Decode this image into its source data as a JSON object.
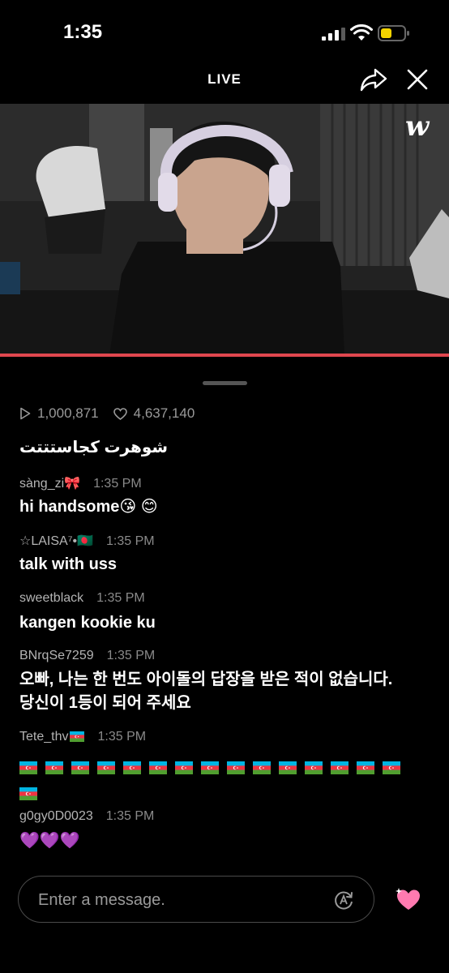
{
  "status_bar": {
    "time": "1:35"
  },
  "header": {
    "title": "LIVE"
  },
  "video": {
    "watermark": "w"
  },
  "stats": {
    "plays": "1,000,871",
    "likes": "4,637,140"
  },
  "chat": [
    {
      "text": "شوهرت كجاستتتت"
    },
    {
      "user": "sàng_zi🎀",
      "time": "1:35 PM",
      "text": "hi handsome😘 😊"
    },
    {
      "user": "☆LAISA⁷•🇧🇩",
      "time": "1:35 PM",
      "text": "talk with uss"
    },
    {
      "user": "sweetblack",
      "time": "1:35 PM",
      "text": "kangen kookie ku"
    },
    {
      "user": "BNrqSe7259",
      "time": "1:35 PM",
      "text_line1": "오빠, 나는 한 번도 아이돌의 답장을 받은 적이 없습니다.",
      "text_line2": "당신이 1등이 되어 주세요"
    },
    {
      "user": "Tete_thv",
      "time": "1:35 PM",
      "flag_count": 16
    },
    {
      "user": "g0gy0D0023",
      "time": "1:35 PM",
      "text": "💜💜💜"
    }
  ],
  "input": {
    "placeholder": "Enter a message."
  },
  "colors": {
    "progress": "#e0474f",
    "heart": "#ff7ab0"
  }
}
